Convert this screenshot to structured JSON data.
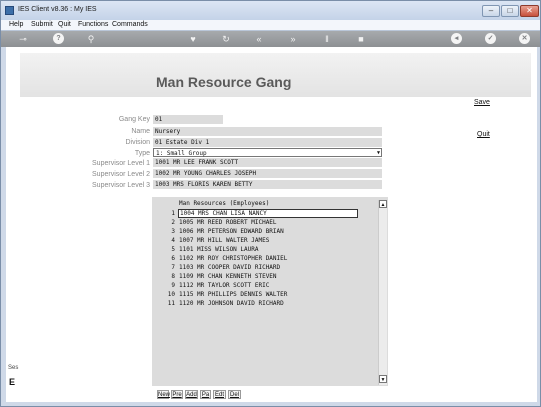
{
  "window": {
    "title": "IES Client v8.36 : My IES"
  },
  "menubar": {
    "items": [
      "Help",
      "Submit",
      "Quit",
      "Functions",
      "Commands"
    ]
  },
  "toolbar": {
    "icons": [
      "key-icon",
      "help-icon",
      "search-icon",
      "heart-icon",
      "refresh-icon",
      "rewind-icon",
      "fast-forward-icon",
      "pause-icon",
      "stop-icon",
      "back-icon",
      "confirm-icon",
      "cancel-icon"
    ]
  },
  "page": {
    "title": "Man Resource Gang",
    "save_label": "Save",
    "quit_label": "Quit"
  },
  "form": {
    "gang_key_label": "Gang Key",
    "gang_key": "01",
    "name_label": "Name",
    "name": "Nursery",
    "division_label": "Division",
    "division": "01 Estate Div 1",
    "type_label": "Type",
    "type": "1: Small Group",
    "sup1_label": "Supervisor Level 1",
    "sup1": "1001 MR LEE FRANK SCOTT",
    "sup2_label": "Supervisor Level 2",
    "sup2": "1002 MR YOUNG CHARLES JOSEPH",
    "sup3_label": "Supervisor Level 3",
    "sup3": "1003 MRS FLORIS KAREN BETTY"
  },
  "employees": {
    "header": "Man Resources (Employees)",
    "rows": [
      {
        "num": "1",
        "text": "1004 MRS CHAN LISA NANCY"
      },
      {
        "num": "2",
        "text": "1005 MR REED ROBERT MICHAEL"
      },
      {
        "num": "3",
        "text": "1006 MR PETERSON EDWARD BRIAN"
      },
      {
        "num": "4",
        "text": "1007 MR HILL WALTER JAMES"
      },
      {
        "num": "5",
        "text": "1101 MISS WILSON LAURA"
      },
      {
        "num": "6",
        "text": "1102 MR ROY CHRISTOPHER DANIEL"
      },
      {
        "num": "7",
        "text": "1103 MR COOPER DAVID RICHARD"
      },
      {
        "num": "8",
        "text": "1109 MR CHAN KENNETH STEVEN"
      },
      {
        "num": "9",
        "text": "1112 MR TAYLOR SCOTT ERIC"
      },
      {
        "num": "10",
        "text": "1115 MR PHILLIPS DENNIS WALTER"
      },
      {
        "num": "11",
        "text": "1120 MR JOHNSON DAVID RICHARD"
      }
    ],
    "buttons": [
      "New",
      "Pre",
      "Add",
      "Pa",
      "Edt",
      "Del"
    ]
  },
  "sidebar": {
    "partial_label": "Ses",
    "partial_letter": "E"
  }
}
